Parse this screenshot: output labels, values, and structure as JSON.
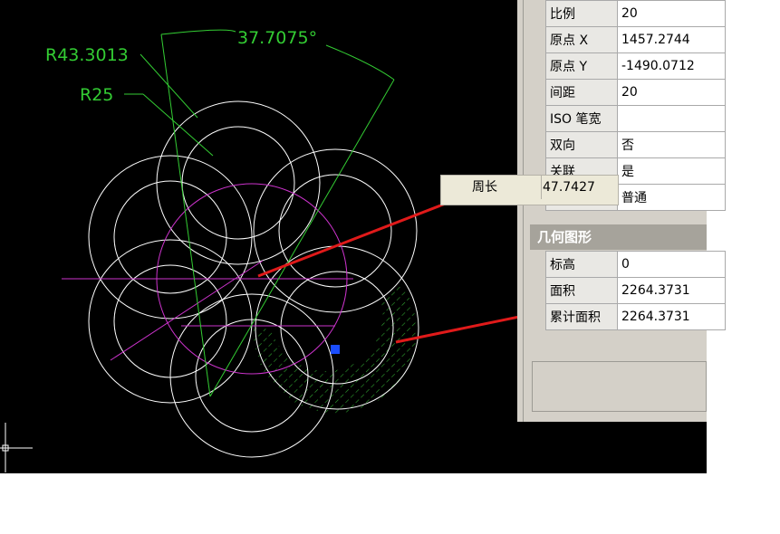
{
  "drawing": {
    "dim_angle": "37.7075°",
    "dim_radius_large": "R43.3013",
    "dim_radius_small": "R25"
  },
  "tooltip": {
    "label": "周长",
    "value": "47.7427"
  },
  "properties": {
    "rows": [
      {
        "label": "比例",
        "value": "20"
      },
      {
        "label": "原点 X",
        "value": "1457.2744"
      },
      {
        "label": "原点 Y",
        "value": "-1490.0712"
      },
      {
        "label": "间距",
        "value": "20"
      },
      {
        "label": "ISO 笔宽",
        "value": ""
      },
      {
        "label": "双向",
        "value": "否"
      },
      {
        "label": "关联",
        "value": "是"
      },
      {
        "label": "",
        "value": "普通"
      }
    ],
    "geometry_header": "几何图形",
    "geometry_rows": [
      {
        "label": "标高",
        "value": "0"
      },
      {
        "label": "面积",
        "value": "2264.3731"
      },
      {
        "label": "累计面积",
        "value": "2264.3731"
      }
    ]
  },
  "colors": {
    "background": "#000000",
    "geometry": "#ffffff",
    "dimension": "#33cc33",
    "construction": "#cc33cc",
    "leader": "#e01a1a",
    "grip": "#1a4dff"
  }
}
